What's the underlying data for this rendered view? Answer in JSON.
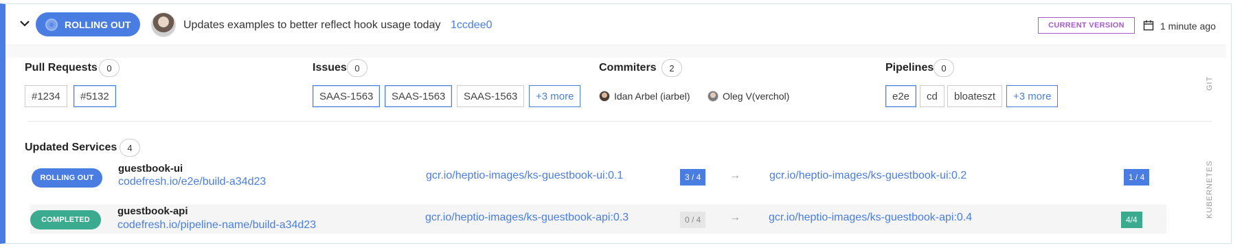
{
  "header": {
    "status_label": "ROLLING OUT",
    "commit_message": "Updates examples to better reflect hook usage today",
    "commit_sha": "1ccdee0",
    "current_version_label": "CURRENT VERSION",
    "time_ago": "1 minute ago",
    "icons": {
      "expand": "chevron-down-icon",
      "calendar": "calendar-icon"
    }
  },
  "git": {
    "side_label": "GIT",
    "pull_requests": {
      "title": "Pull Requests",
      "count": "0",
      "tags": [
        "#1234",
        "#5132"
      ]
    },
    "issues": {
      "title": "Issues",
      "count": "0",
      "tags": [
        "SAAS-1563",
        "SAAS-1563",
        "SAAS-1563"
      ],
      "more": "+3 more"
    },
    "commiters": {
      "title": "Commiters",
      "count": "2",
      "people": [
        "Idan Arbel (iarbel)",
        "Oleg V(verchol)"
      ]
    },
    "pipelines": {
      "title": "Pipelines",
      "count": "0",
      "tags": [
        "e2e",
        "cd",
        "bloateszt"
      ],
      "more": "+3 more"
    }
  },
  "services": {
    "side_label": "KUBERNETES",
    "title": "Updated Services",
    "count": "4",
    "rows": [
      {
        "status": "ROLLING OUT",
        "name": "guestbook-ui",
        "build_link": "codefresh.io/e2e/build-a34d23",
        "from_image": "gcr.io/heptio-images/ks-guestbook-ui:0.1",
        "from_replicas": "3 / 4",
        "arrow": "→",
        "to_image": "gcr.io/heptio-images/ks-guestbook-ui:0.2",
        "to_replicas": "1 / 4"
      },
      {
        "status": "COMPLETED",
        "name": "guestbook-api",
        "build_link": "codefresh.io/pipeline-name/build-a34d23",
        "from_image": "gcr.io/heptio-images/ks-guestbook-api:0.3",
        "from_replicas": "0 / 4",
        "arrow": "→",
        "to_image": "gcr.io/heptio-images/ks-guestbook-api:0.4",
        "to_replicas": "4/4"
      }
    ]
  },
  "colors": {
    "accent": "#4a7de2",
    "current_version": "#a55cc8",
    "completed": "#3bab8f",
    "rolling_out": "#4a7de2"
  }
}
